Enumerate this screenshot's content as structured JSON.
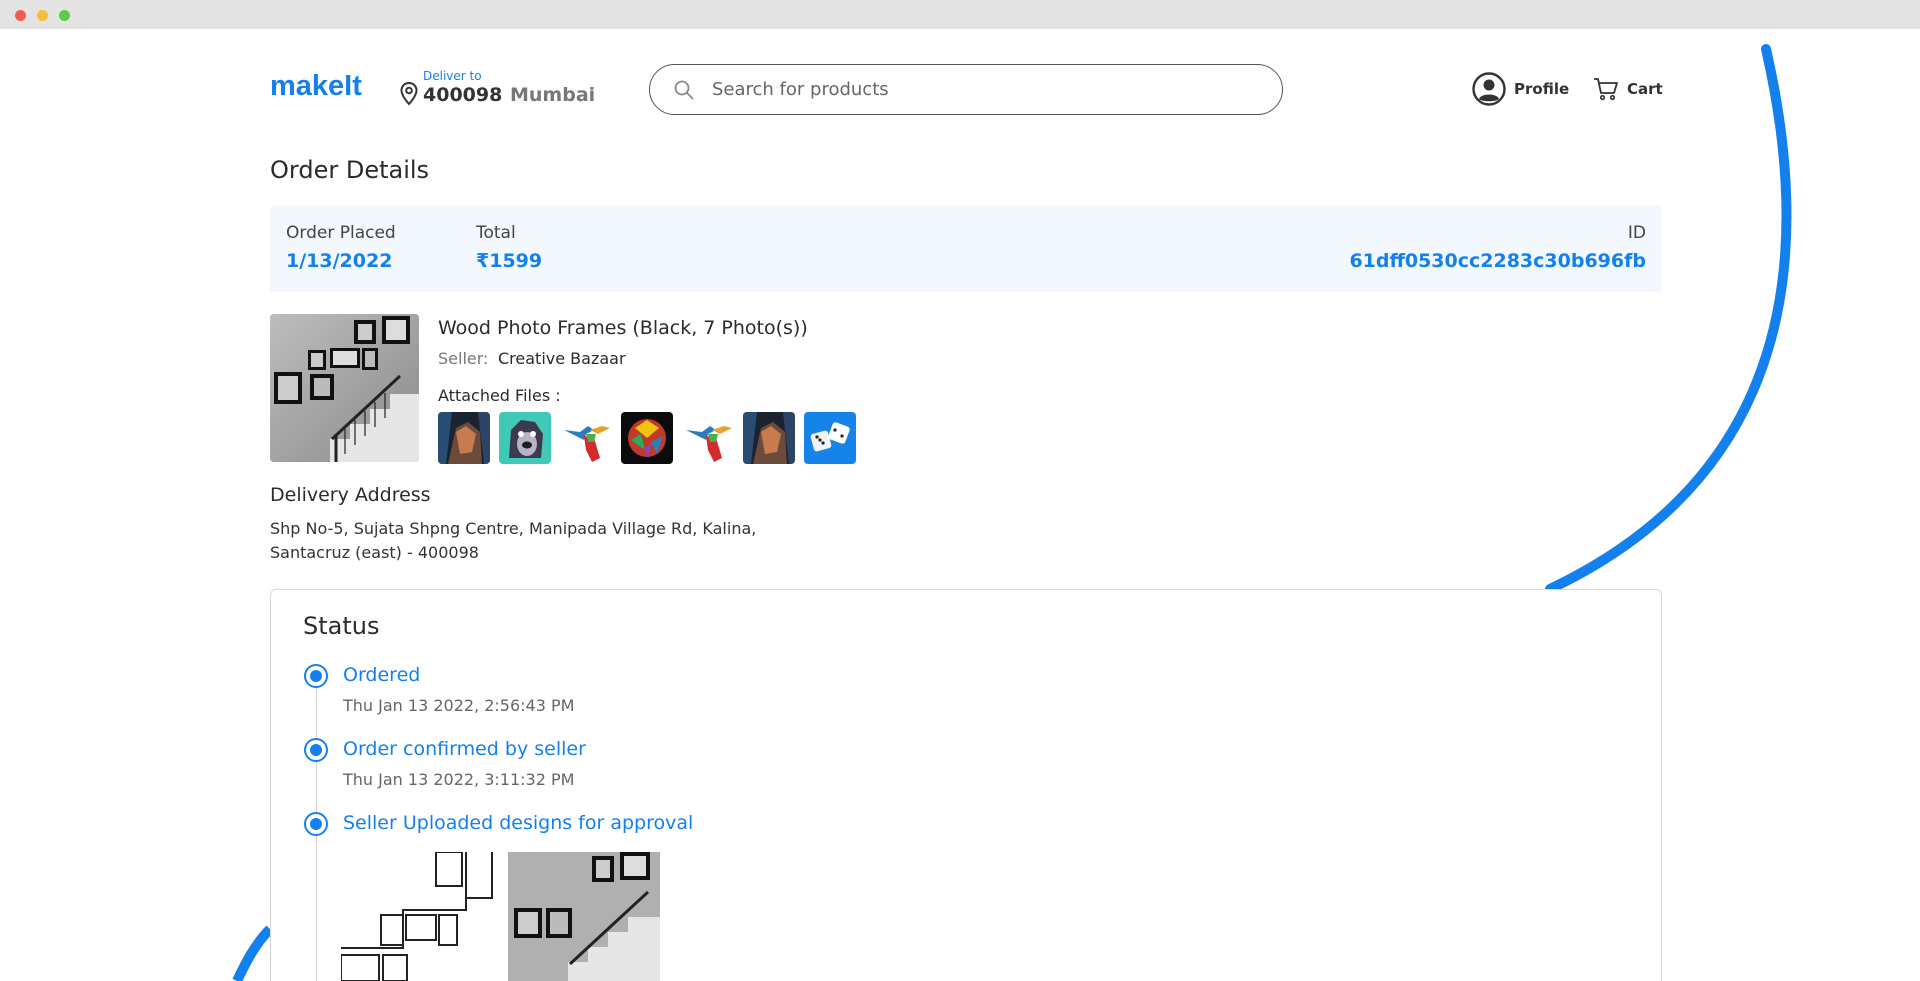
{
  "header": {
    "logo": "makeIt",
    "deliver_label": "Deliver to",
    "pincode": "400098",
    "city": "Mumbai",
    "search_placeholder": "Search for products",
    "profile_label": "Profile",
    "cart_label": "Cart"
  },
  "order": {
    "page_title": "Order Details",
    "placed_label": "Order Placed",
    "placed_value": "1/13/2022",
    "total_label": "Total",
    "total_value": "₹1599",
    "id_label": "ID",
    "id_value": "61dff0530cc2283c30b696fb"
  },
  "product": {
    "title": "Wood Photo Frames (Black, 7 Photo(s))",
    "seller_label": "Seller:",
    "seller_name": "Creative Bazaar",
    "files_label": "Attached Files :",
    "files": [
      "abstract-portrait",
      "dog-painting",
      "hummingbird",
      "colorful-lion",
      "hummingbird",
      "abstract-portrait",
      "dice"
    ]
  },
  "address": {
    "title": "Delivery Address",
    "line1": "Shp No-5, Sujata Shpng Centre, Manipada Village Rd, Kalina,",
    "line2": "Santacruz (east) - 400098"
  },
  "status": {
    "title": "Status",
    "steps": [
      {
        "title": "Ordered",
        "time": "Thu Jan 13 2022, 2:56:43 PM"
      },
      {
        "title": "Order confirmed by seller",
        "time": "Thu Jan 13 2022, 3:11:32 PM"
      },
      {
        "title": "Seller Uploaded designs for approval",
        "time": ""
      }
    ]
  },
  "colors": {
    "accent": "#1480ee",
    "summary_bg": "#f2f8fd",
    "border": "#d6d6d6"
  }
}
